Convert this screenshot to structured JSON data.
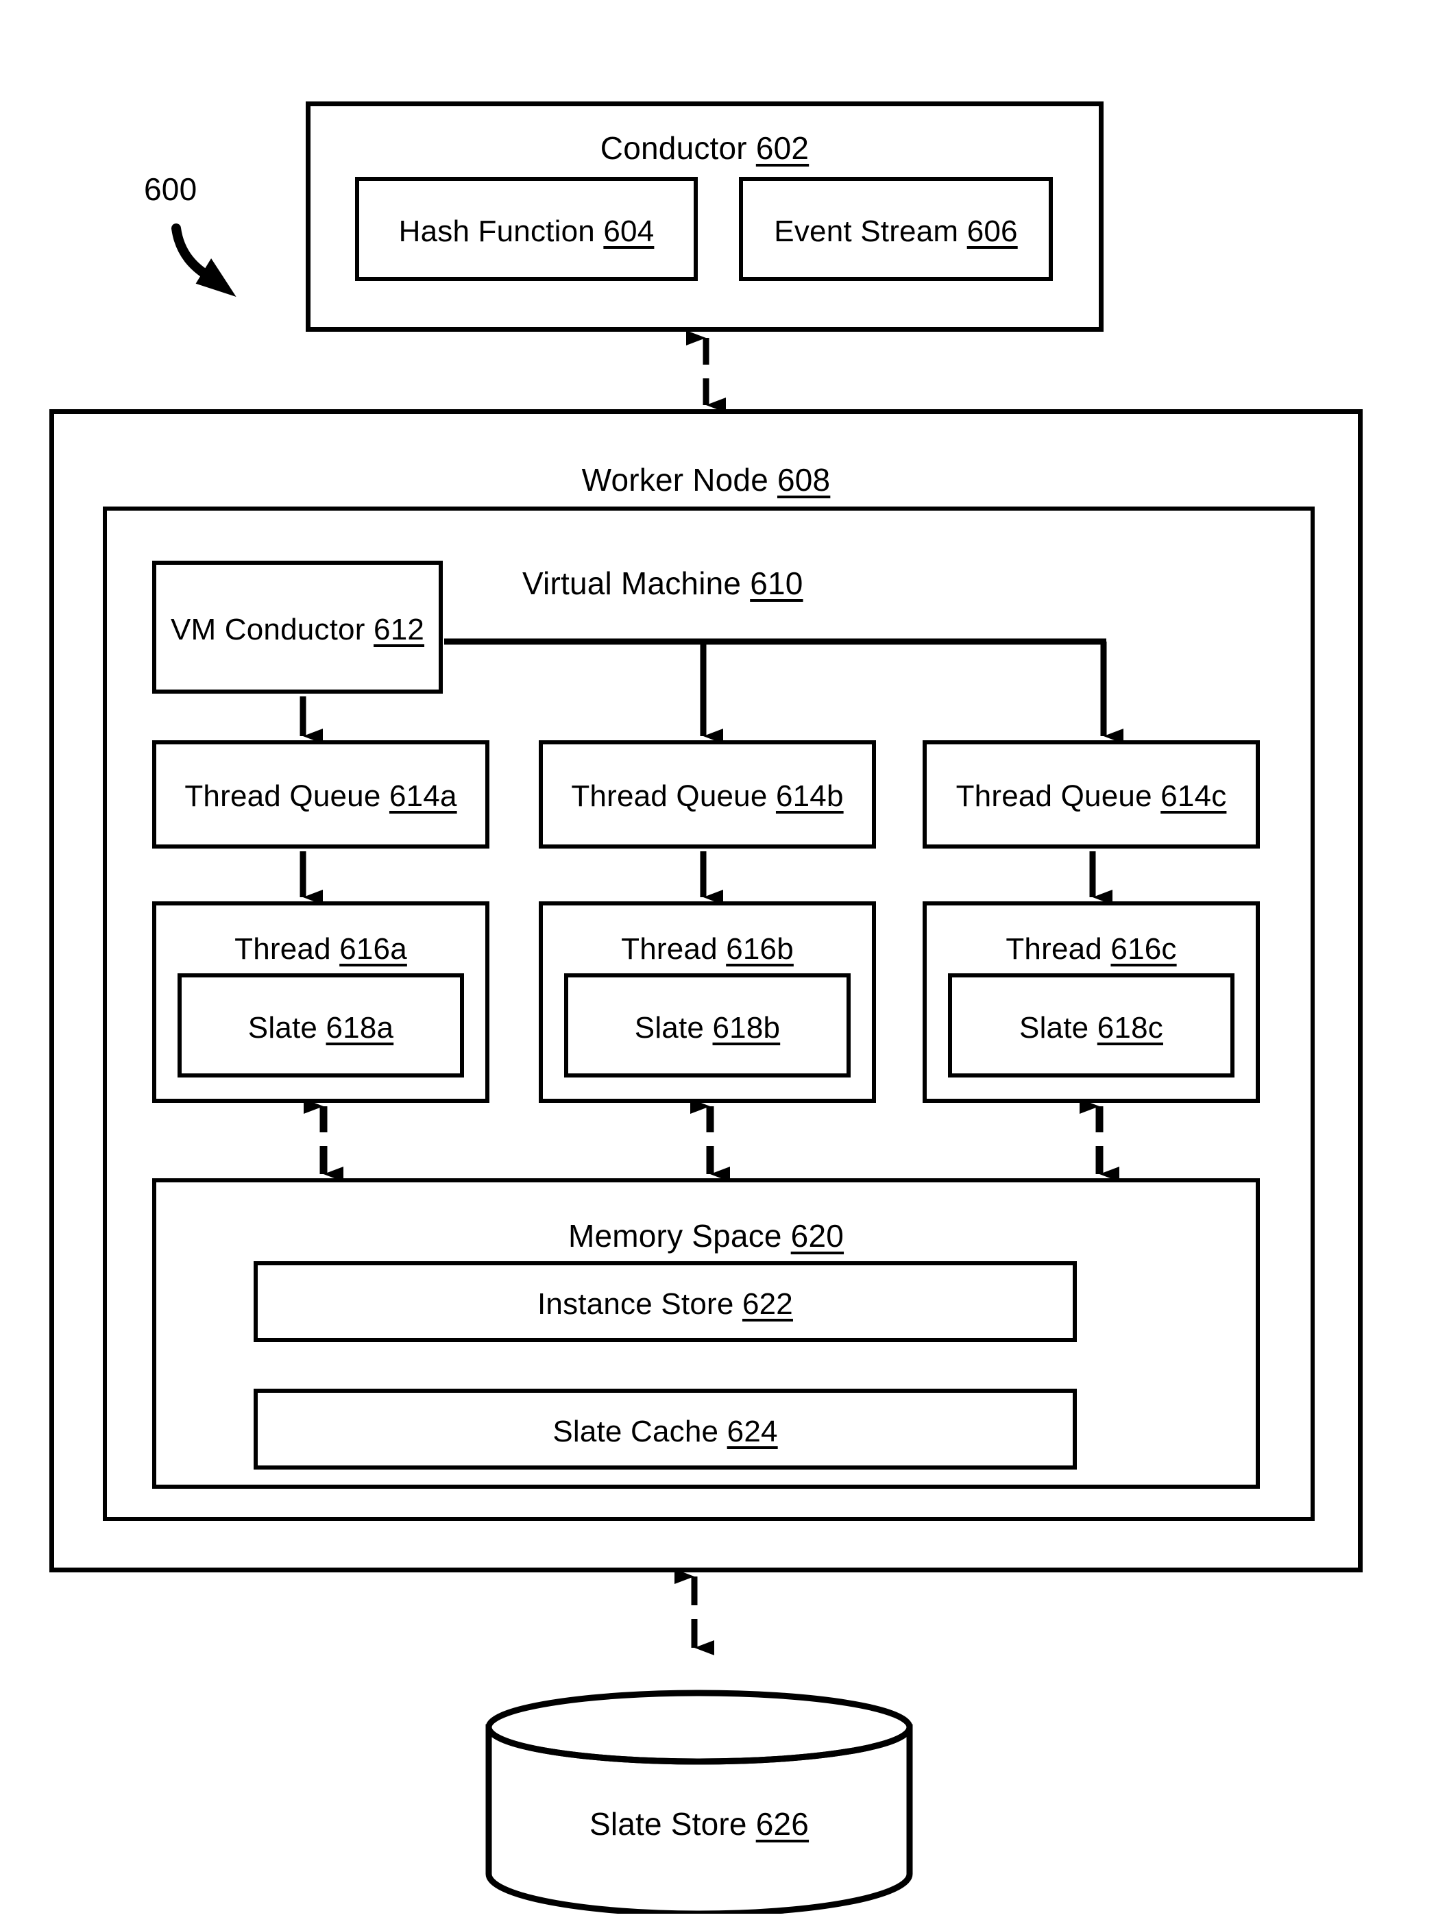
{
  "figure": {
    "number_label": "600",
    "callout_arrow": "curved-arrow-down-right"
  },
  "conductor": {
    "title": "Conductor",
    "ref": "602",
    "children": [
      {
        "title": "Hash Function",
        "ref": "604",
        "name": "hash-function-box"
      },
      {
        "title": "Event Stream",
        "ref": "606",
        "name": "event-stream-box"
      }
    ]
  },
  "worker_node": {
    "title": "Worker Node",
    "ref": "608",
    "virtual_machine": {
      "title": "Virtual Machine",
      "ref": "610",
      "vm_conductor": {
        "title": "VM Conductor",
        "ref": "612"
      },
      "columns": [
        {
          "thread_queue": {
            "title": "Thread Queue",
            "ref": "614a"
          },
          "thread": {
            "title": "Thread",
            "ref": "616a"
          },
          "slate": {
            "title": "Slate",
            "ref": "618a"
          }
        },
        {
          "thread_queue": {
            "title": "Thread Queue",
            "ref": "614b"
          },
          "thread": {
            "title": "Thread",
            "ref": "616b"
          },
          "slate": {
            "title": "Slate",
            "ref": "618b"
          }
        },
        {
          "thread_queue": {
            "title": "Thread Queue",
            "ref": "614c"
          },
          "thread": {
            "title": "Thread",
            "ref": "616c"
          },
          "slate": {
            "title": "Slate",
            "ref": "618c"
          }
        }
      ],
      "memory_space": {
        "title": "Memory Space",
        "ref": "620",
        "children": [
          {
            "title": "Instance Store",
            "ref": "622",
            "name": "instance-store-box"
          },
          {
            "title": "Slate Cache",
            "ref": "624",
            "name": "slate-cache-box"
          }
        ]
      }
    }
  },
  "slate_store": {
    "title": "Slate Store",
    "ref": "626",
    "shape": "database-cylinder"
  },
  "colors": {
    "stroke": "#000000",
    "fill": "#ffffff",
    "text": "#000000"
  }
}
